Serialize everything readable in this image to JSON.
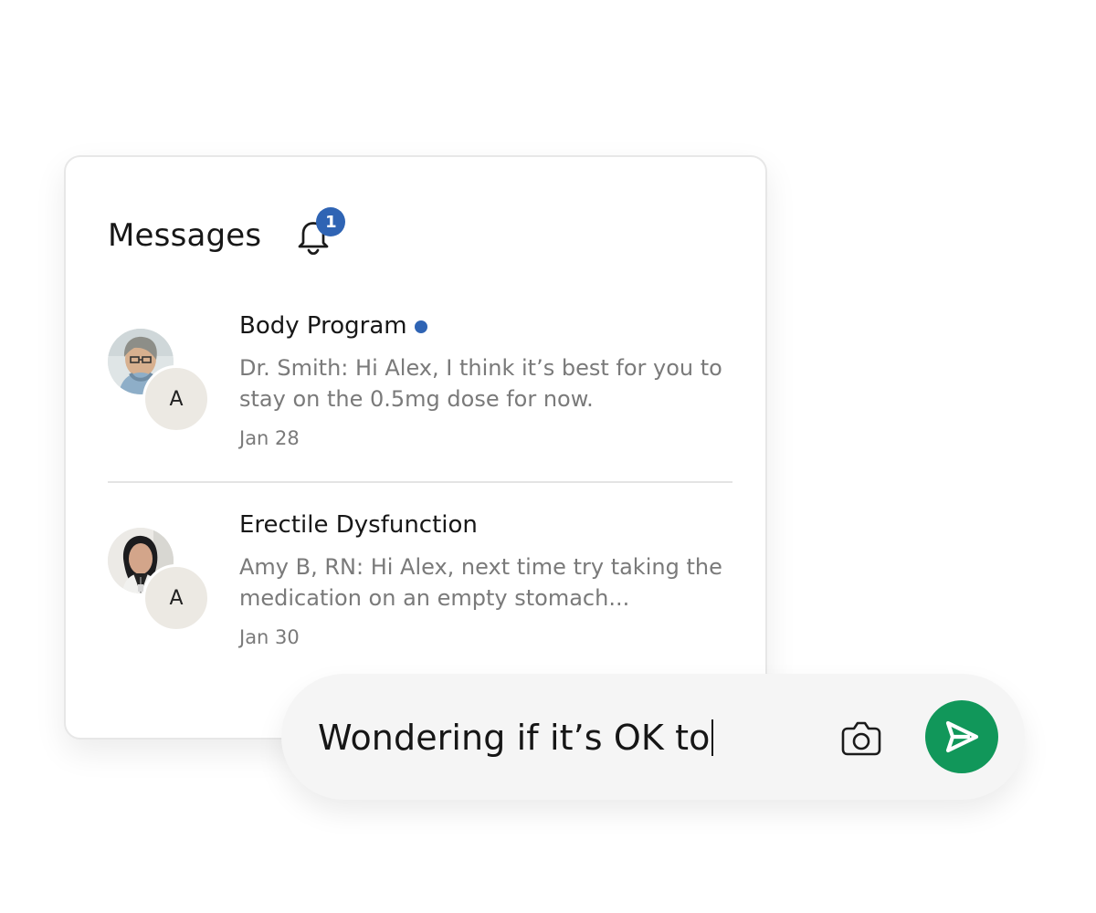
{
  "messages_panel": {
    "title": "Messages",
    "notification_count": "1",
    "icons": {
      "notifications": "bell-icon"
    }
  },
  "threads": [
    {
      "title": "Body Program",
      "preview": "Dr. Smith: Hi Alex, I think it’s best for you to stay on the 0.5mg dose for now.",
      "date": "Jan 28",
      "initial": "A",
      "unread": true,
      "avatar": "care-provider-avatar"
    },
    {
      "title": "Erectile Dysfunction",
      "preview": "Amy B, RN: Hi Alex, next time try taking the medication on an empty stomach...",
      "date": "Jan 30",
      "initial": "A",
      "unread": false,
      "avatar": "care-provider-avatar"
    }
  ],
  "composer": {
    "value": "Wondering if it’s OK to",
    "camera_icon": "camera-icon",
    "send_icon": "send-icon"
  },
  "colors": {
    "accent_blue": "#2f64b4",
    "send_green": "#11975a",
    "text_primary": "#171717",
    "text_secondary": "#7a7a7a",
    "avatar_initial_bg": "#ece9e3",
    "composer_bg": "#f5f5f5",
    "divider": "#e4e4e4"
  }
}
